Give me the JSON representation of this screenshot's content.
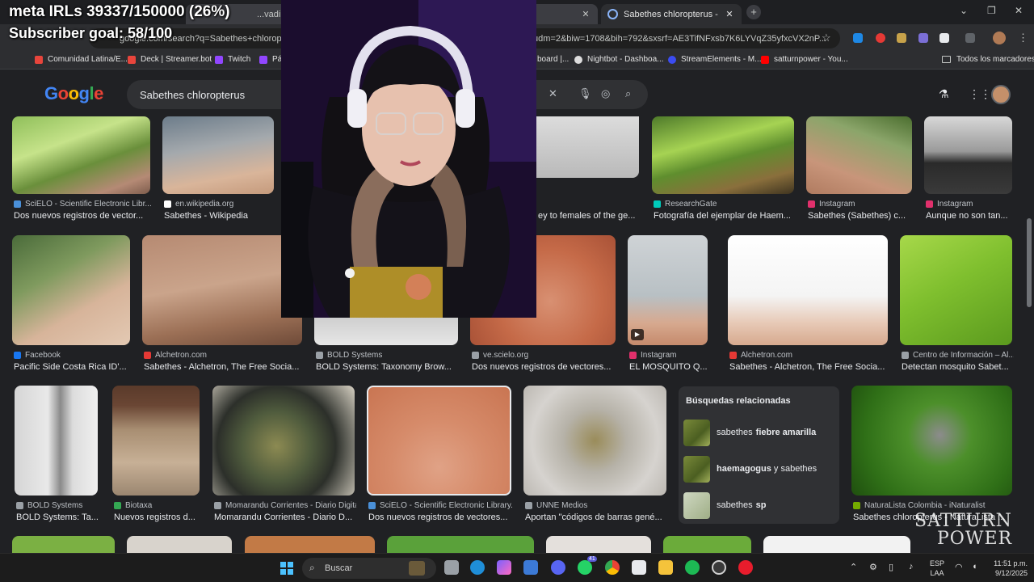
{
  "stream": {
    "meta": "meta IRLs 39337/150000 (26%)",
    "meta_progress": 0.26,
    "goal": "Subscriber goal: 58/100",
    "watermark_line1": "SATTURN",
    "watermark_line2": "POWER"
  },
  "browser": {
    "tabs": [
      {
        "title": "...vadil | Explorar",
        "active": false
      },
      {
        "title": "Sabethes chloropterus - Buscar",
        "active": true
      }
    ],
    "url": "google.com/search?q=Sabethes+chloropter",
    "url_tail": "udm=2&biw=1708&bih=792&sxsrf=AE3TifNFxsb7K6LYVqZ35yfxcVX2nP...",
    "bookmarks": [
      {
        "label": "Comunidad Latina/E...",
        "color": "#e8453c"
      },
      {
        "label": "Deck | Streamer.bot",
        "color": "#e8453c"
      },
      {
        "label": "Twitch",
        "color": "#9146ff"
      },
      {
        "label": "Pág",
        "color": "#9146ff"
      },
      {
        "label": "board |...",
        "color": "#444"
      },
      {
        "label": "Nightbot - Dashboa...",
        "color": "#dddddd"
      },
      {
        "label": "StreamElements - M...",
        "color": "#3b4cf2"
      },
      {
        "label": "satturnpower - You...",
        "color": "#ff0000"
      }
    ],
    "bookmarks_folder": "Todos los marcadores"
  },
  "google": {
    "logo": "Google",
    "query": "Sabethes chloropterus",
    "rows": [
      [
        {
          "source": "SciELO - Scientific Electronic Libr...",
          "caption": "Dos nuevos registros de vector...",
          "icon_color": "#4a90d9"
        },
        {
          "source": "en.wikipedia.org",
          "caption": "Sabethes - Wikipedia",
          "icon_color": "#ffffff"
        },
        {
          "source": "",
          "caption": "ey to females of the ge...",
          "icon_color": "#888"
        },
        {
          "source": "ResearchGate",
          "caption": "Fotografía del ejemplar de Haem...",
          "icon_color": "#00ccbb"
        },
        {
          "source": "Instagram",
          "caption": "Sabethes (Sabethes) c...",
          "icon_color": "#e1306c"
        },
        {
          "source": "Instagram",
          "caption": "Aunque no son tan...",
          "icon_color": "#e1306c"
        }
      ],
      [
        {
          "source": "Facebook",
          "caption": "Pacific Side Costa Rica ID'...",
          "icon_color": "#1877f2"
        },
        {
          "source": "Alchetron.com",
          "caption": "Sabethes - Alchetron, The Free Socia...",
          "icon_color": "#e53935"
        },
        {
          "source": "BOLD Systems",
          "caption": "BOLD Systems: Taxonomy Brow...",
          "icon_color": "#9aa0a6"
        },
        {
          "source": "ve.scielo.org",
          "caption": "Dos nuevos registros de vectores...",
          "icon_color": "#9aa0a6"
        },
        {
          "source": "Instagram",
          "caption": "EL MOSQUITO Q...",
          "icon_color": "#e1306c"
        },
        {
          "source": "Alchetron.com",
          "caption": "Sabethes - Alchetron, The Free Socia...",
          "icon_color": "#e53935"
        },
        {
          "source": "Centro de Información – Al...",
          "caption": "Detectan mosquito Sabet...",
          "icon_color": "#9aa0a6"
        }
      ],
      [
        {
          "source": "BOLD Systems",
          "caption": "BOLD Systems: Ta...",
          "icon_color": "#9aa0a6"
        },
        {
          "source": "Biotaxa",
          "caption": "Nuevos registros d...",
          "icon_color": "#34a853"
        },
        {
          "source": "Momarandu Corrientes - Diario Digital",
          "caption": "Momarandu Corrientes - Diario D...",
          "icon_color": "#9aa0a6"
        },
        {
          "source": "SciELO - Scientific Electronic Library...",
          "caption": "Dos nuevos registros de vectores...",
          "icon_color": "#4a90d9"
        },
        {
          "source": "UNNE Medios",
          "caption": "Aportan \"códigos de barras gené...",
          "icon_color": "#9aa0a6"
        },
        {
          "source": "NaturaLista Colombia - iNaturalist",
          "caption": "Sabethes chloropterus - NaturaLista ...",
          "icon_color": "#74ac00"
        }
      ]
    ],
    "related": {
      "title": "Búsquedas relacionadas",
      "items": [
        {
          "pre": "sabethes",
          "bold": "fiebre amarilla",
          "post": ""
        },
        {
          "pre": "",
          "bold": "haemagogus",
          "post": " y sabethes"
        },
        {
          "pre": "sabethes",
          "bold": "sp",
          "post": ""
        }
      ]
    }
  },
  "taskbar": {
    "search": "Buscar",
    "lang_line1": "ESP",
    "lang_line2": "LAA",
    "time": "11:51 p.m.",
    "date": "9/12/2025",
    "badge_count": "41"
  }
}
